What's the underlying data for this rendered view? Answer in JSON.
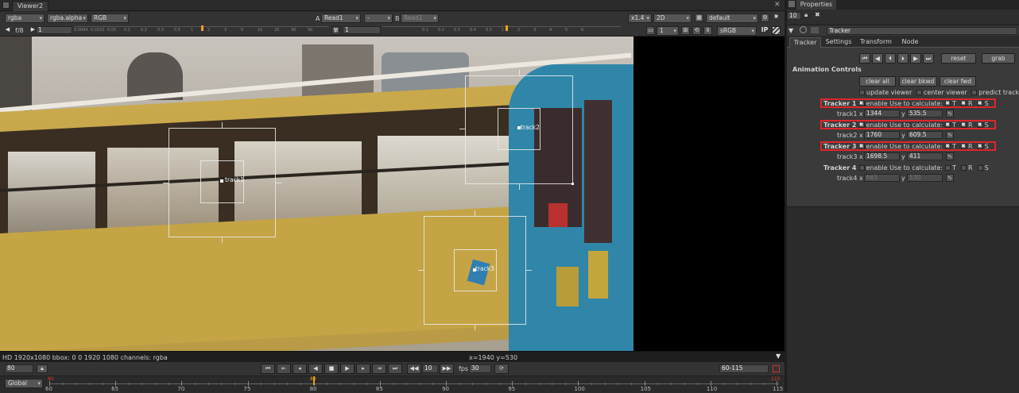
{
  "viewer": {
    "tab_title": "Viewer2",
    "channel_set": "rgba",
    "alpha_channel": "rgba.alpha",
    "display": "RGB",
    "a_label": "A",
    "a_input": "Read1",
    "mode": "-",
    "b_label": "B",
    "b_input": "Read1",
    "zoom": "x1.4",
    "view_mode": "2D",
    "lut": "default",
    "frame_step": "f/8",
    "frame_value": "1",
    "y_label": "Y",
    "y_value": "1",
    "proxy": "1",
    "colorspace": "sRGB",
    "ip_label": "IP",
    "ruler_ticks": [
      "0.0084",
      "0.0152",
      "0.05",
      "0.1",
      "0.2",
      "0.3",
      "0.5",
      "1",
      "2",
      "3",
      "5",
      "10",
      "20",
      "30",
      "50"
    ],
    "ruler_ticks_right": [
      "0.1",
      "0.2",
      "0.3",
      "0.4",
      "0.5",
      "1",
      "2",
      "3",
      "4",
      "5",
      "6"
    ],
    "info_text": "HD 1920x1080 bbox: 0 0 1920 1080 channels: rgba",
    "coords_text": "x=1940 y=530",
    "tracks": [
      {
        "label": "track1"
      },
      {
        "label": "track2"
      },
      {
        "label": "track3"
      }
    ]
  },
  "timeline": {
    "current_frame": "80",
    "increment": "10",
    "fps_label": "fps",
    "fps": "30",
    "range": "60-115",
    "global": "Global",
    "ticks": [
      "60",
      "65",
      "70",
      "75",
      "80",
      "85",
      "90",
      "95",
      "100",
      "105",
      "110",
      "115"
    ],
    "marker_left": "60",
    "marker_mid": "80",
    "marker_right": "115"
  },
  "properties": {
    "tab_title": "Properties",
    "max_panels": "10",
    "node_name": "Tracker",
    "tabs": [
      "Tracker",
      "Settings",
      "Transform",
      "Node"
    ],
    "reset": "reset",
    "grab": "grab",
    "animation_controls": "Animation Controls",
    "clear_all": "clear all",
    "clear_bkwd": "clear bkwd",
    "clear_fwd": "clear fwd",
    "update_viewer": "update viewer",
    "center_viewer": "center viewer",
    "predict_track": "predict track",
    "enable": "enable",
    "use_to_calc": "Use to calculate:",
    "t": "T",
    "r": "R",
    "s": "S",
    "x": "x",
    "y": "y",
    "trackers": [
      {
        "title": "Tracker 1",
        "track": "track1",
        "x": "1344",
        "y": "535.5",
        "enabled": true
      },
      {
        "title": "Tracker 2",
        "track": "track2",
        "x": "1760",
        "y": "609.5",
        "enabled": true
      },
      {
        "title": "Tracker 3",
        "track": "track3",
        "x": "1698.5",
        "y": "411",
        "enabled": true
      },
      {
        "title": "Tracker 4",
        "track": "track4",
        "x": "665",
        "y": "530",
        "enabled": false
      }
    ],
    "highlight_color": "#e0262a"
  }
}
